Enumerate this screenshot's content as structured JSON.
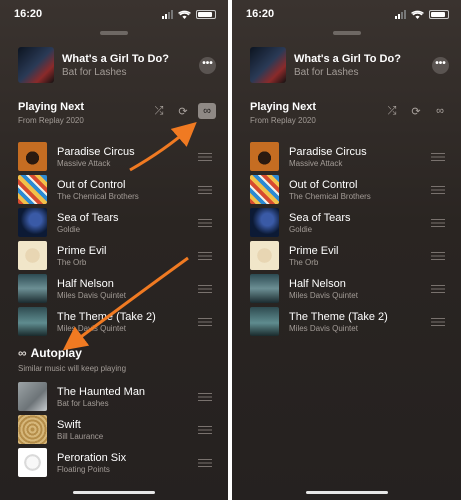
{
  "panels": [
    {
      "status": {
        "time": "16:20"
      },
      "now_playing": {
        "title": "What's a Girl To Do?",
        "artist": "Bat for Lashes",
        "more_icon": "ellipsis-icon"
      },
      "playing_next": {
        "title": "Playing Next",
        "subtitle": "From Replay 2020",
        "infinity_active": true
      },
      "tracks": [
        {
          "title": "Paradise Circus",
          "artist": "Massive Attack"
        },
        {
          "title": "Out of Control",
          "artist": "The Chemical Brothers"
        },
        {
          "title": "Sea of Tears",
          "artist": "Goldie"
        },
        {
          "title": "Prime Evil",
          "artist": "The Orb"
        },
        {
          "title": "Half Nelson",
          "artist": "Miles Davis Quintet"
        },
        {
          "title": "The Theme (Take 2)",
          "artist": "Miles Davis Quintet"
        }
      ],
      "autoplay": {
        "title": "Autoplay",
        "subtitle": "Similar music will keep playing"
      },
      "autoplay_tracks": [
        {
          "title": "The Haunted Man",
          "artist": "Bat for Lashes"
        },
        {
          "title": "Swift",
          "artist": "Bill Laurance"
        },
        {
          "title": "Peroration Six",
          "artist": "Floating Points"
        }
      ],
      "accent_arrow_color": "#f07a22"
    },
    {
      "status": {
        "time": "16:20"
      },
      "now_playing": {
        "title": "What's a Girl To Do?",
        "artist": "Bat for Lashes",
        "more_icon": "ellipsis-icon"
      },
      "playing_next": {
        "title": "Playing Next",
        "subtitle": "From Replay 2020",
        "infinity_active": false
      },
      "tracks": [
        {
          "title": "Paradise Circus",
          "artist": "Massive Attack"
        },
        {
          "title": "Out of Control",
          "artist": "The Chemical Brothers"
        },
        {
          "title": "Sea of Tears",
          "artist": "Goldie"
        },
        {
          "title": "Prime Evil",
          "artist": "The Orb"
        },
        {
          "title": "Half Nelson",
          "artist": "Miles Davis Quintet"
        },
        {
          "title": "The Theme (Take 2)",
          "artist": "Miles Davis Quintet"
        }
      ]
    }
  ]
}
